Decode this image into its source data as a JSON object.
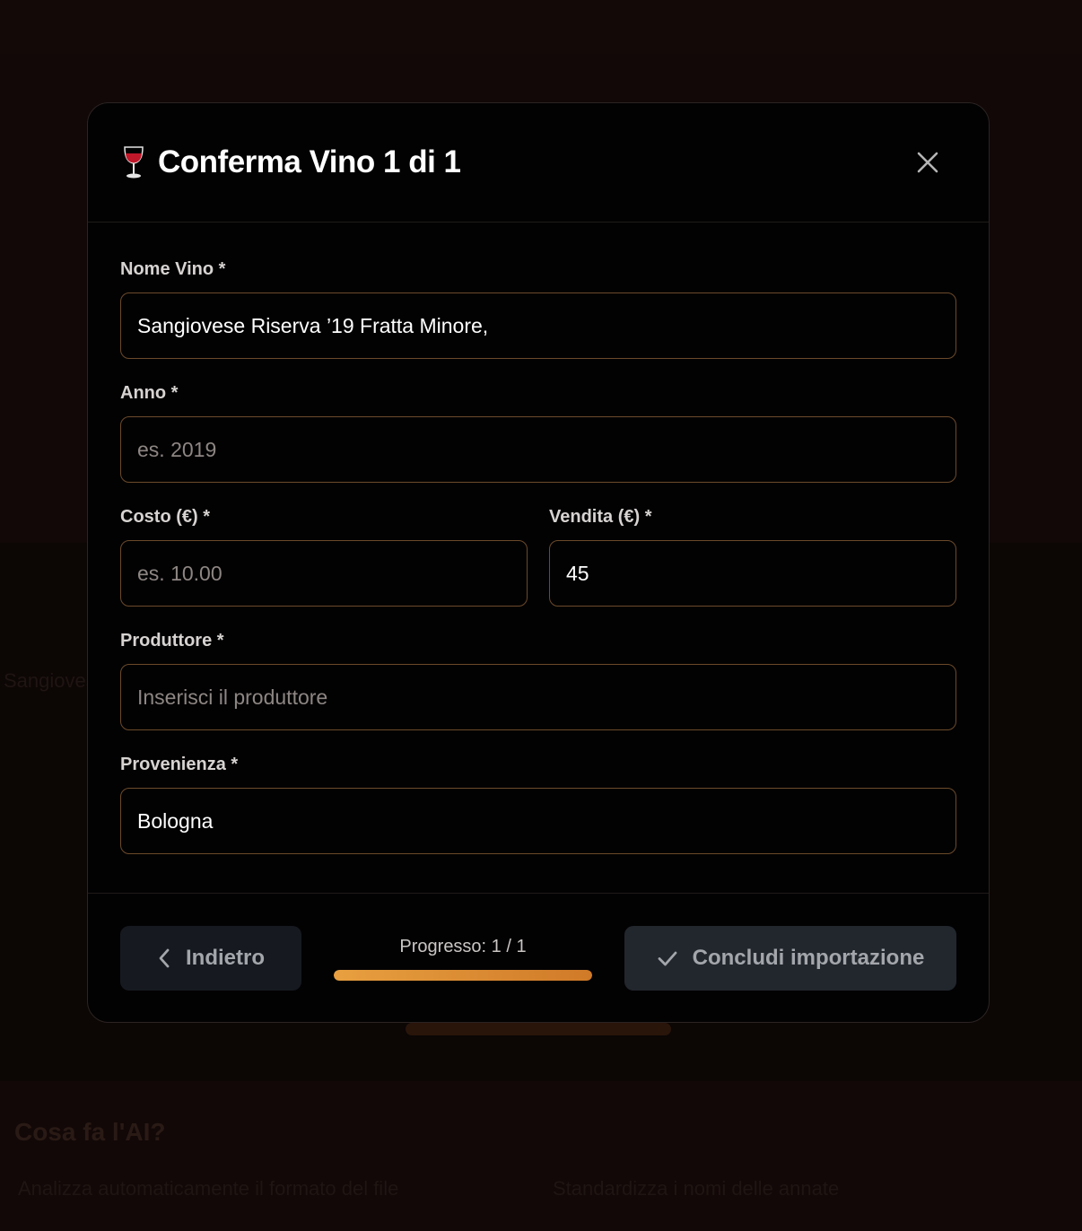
{
  "background": {
    "section_title": "Cosa fa l'AI?",
    "list_item_1": "Analizza automaticamente il formato del file",
    "list_item_2": "Standardizza i nomi delle annate",
    "side_text": "Sangiovese"
  },
  "modal": {
    "title": "Conferma Vino 1 di 1",
    "title_icon": "wine-glass-icon",
    "close_icon": "close-icon"
  },
  "form": {
    "nome_vino": {
      "label": "Nome Vino *",
      "value": "Sangiovese Riserva ’19 Fratta Minore,",
      "placeholder": ""
    },
    "anno": {
      "label": "Anno *",
      "value": "",
      "placeholder": "es. 2019"
    },
    "costo": {
      "label": "Costo (€) *",
      "value": "",
      "placeholder": "es. 10.00"
    },
    "vendita": {
      "label": "Vendita (€) *",
      "value": "45",
      "placeholder": ""
    },
    "produttore": {
      "label": "Produttore *",
      "value": "",
      "placeholder": "Inserisci il produttore"
    },
    "provenienza": {
      "label": "Provenienza *",
      "value": "Bologna",
      "placeholder": ""
    }
  },
  "footer": {
    "back_label": "Indietro",
    "back_icon": "chevron-left-icon",
    "progress_text": "Progresso: 1 / 1",
    "progress_fraction": 1.0,
    "finish_label": "Concludi importazione",
    "finish_icon": "check-icon"
  },
  "colors": {
    "accent": "#e8a040",
    "input_border": "#6b4a2a",
    "modal_bg": "#030203"
  }
}
